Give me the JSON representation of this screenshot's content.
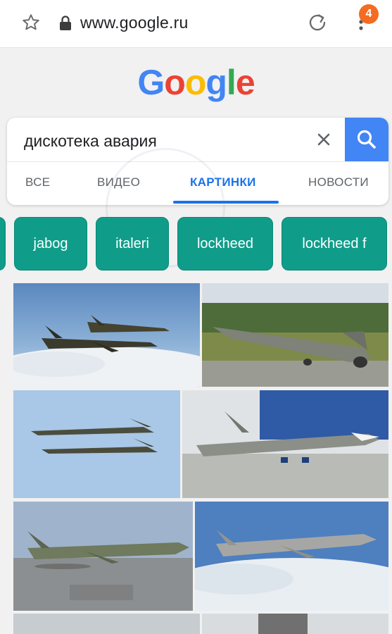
{
  "browser": {
    "url": "www.google.ru",
    "tab_count": "4"
  },
  "logo": {
    "letters": [
      "G",
      "o",
      "o",
      "g",
      "l",
      "e"
    ],
    "colors": [
      "#4285f4",
      "#ea4335",
      "#fbbc05",
      "#4285f4",
      "#34a853",
      "#ea4335"
    ]
  },
  "search": {
    "query": "дискотека авария"
  },
  "tabs": [
    {
      "label": "ВСЕ",
      "active": false
    },
    {
      "label": "ВИДЕО",
      "active": false
    },
    {
      "label": "КАРТИНКИ",
      "active": true
    },
    {
      "label": "НОВОСТИ",
      "active": false
    }
  ],
  "chips": [
    "jabog",
    "italeri",
    "lockheed",
    "lockheed f"
  ],
  "colors": {
    "accent": "#1a73e8",
    "chip": "#0f9d8a",
    "search_button": "#4285f4",
    "badge": "#f36c21"
  },
  "images": [
    {
      "name": "two-jets-over-clouds"
    },
    {
      "name": "jet-on-runway"
    },
    {
      "name": "two-jets-blue-sky"
    },
    {
      "name": "jet-on-display"
    },
    {
      "name": "camo-jet-on-tarmac"
    },
    {
      "name": "jet-over-clouds"
    }
  ]
}
